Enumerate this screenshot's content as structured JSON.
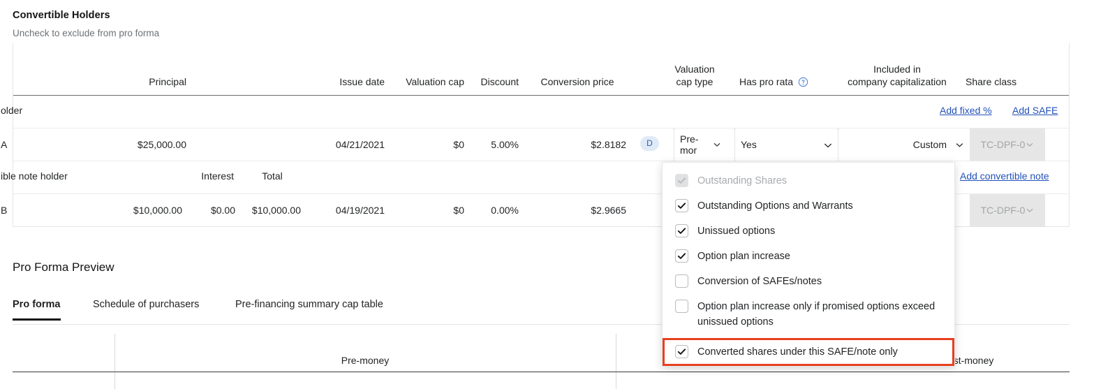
{
  "section": {
    "title": "Convertible Holders",
    "subtitle": "Uncheck to exclude from pro forma"
  },
  "table": {
    "headers": {
      "principal": "Principal",
      "issue_date": "Issue date",
      "valuation_cap": "Valuation cap",
      "discount": "Discount",
      "conversion_price": "Conversion price",
      "valuation_cap_type_line1": "Valuation",
      "valuation_cap_type_line2": "cap type",
      "has_pro_rata": "Has pro rata",
      "has_pro_rata_help_icon": "help-circle-icon",
      "included_line1": "Included in",
      "included_line2": "company capitalization",
      "share_class": "Share class"
    },
    "safe_group": {
      "label": "older",
      "actions": [
        {
          "label": "Add fixed %",
          "name": "add-fixed-percent-link"
        },
        {
          "label": "Add SAFE",
          "name": "add-safe-link"
        }
      ],
      "row": {
        "holder": "A",
        "principal": "$25,000.00",
        "issue_date": "04/21/2021",
        "valuation_cap": "$0",
        "discount": "5.00%",
        "conversion_price": "$2.8182",
        "badge": "D",
        "valuation_cap_type": "Pre-mor",
        "has_pro_rata": "Yes",
        "included_in_company_capitalization": "Custom",
        "share_class": "TC-DPF-0",
        "share_class_disabled": true
      }
    },
    "note_group": {
      "label": "ible note holder",
      "interest_header": "Interest",
      "total_header": "Total",
      "actions": [
        {
          "label": "Add convertible note",
          "name": "add-convertible-note-link"
        }
      ],
      "row": {
        "holder": "B",
        "principal": "$10,000.00",
        "interest": "$0.00",
        "total": "$10,000.00",
        "issue_date": "04/19/2021",
        "valuation_cap": "$0",
        "discount": "0.00%",
        "conversion_price": "$2.9665",
        "share_class": "TC-DPF-0",
        "share_class_disabled": true
      }
    }
  },
  "dropdown": {
    "name": "included-in-company-capitalization-menu",
    "items": [
      {
        "label": "Outstanding Shares",
        "checked": true,
        "disabled": true,
        "highlighted": false
      },
      {
        "label": "Outstanding Options and Warrants",
        "checked": true,
        "disabled": false,
        "highlighted": false
      },
      {
        "label": "Unissued options",
        "checked": true,
        "disabled": false,
        "highlighted": false
      },
      {
        "label": "Option plan increase",
        "checked": true,
        "disabled": false,
        "highlighted": false
      },
      {
        "label": "Conversion of SAFEs/notes",
        "checked": false,
        "disabled": false,
        "highlighted": false
      },
      {
        "label": "Option plan increase only if promised options exceed unissued options",
        "checked": false,
        "disabled": false,
        "highlighted": false
      },
      {
        "label": "Converted shares under this SAFE/note only",
        "checked": true,
        "disabled": false,
        "highlighted": true
      }
    ],
    "highlight_color": "#e8401f"
  },
  "pro_forma": {
    "title": "Pro Forma Preview",
    "tabs": [
      {
        "label": "Pro forma",
        "active": true
      },
      {
        "label": "Schedule of purchasers",
        "active": false
      },
      {
        "label": "Pre-financing summary cap table",
        "active": false
      }
    ],
    "preview_table": {
      "pre_money": "Pre-money",
      "post_money": "ost-money"
    }
  },
  "colors": {
    "link": "#2251b8",
    "badge_bg": "#e0eaf6",
    "badge_text": "#2a5db0",
    "highlight": "#e8401f",
    "disabled_bg": "#e6e6e6"
  }
}
